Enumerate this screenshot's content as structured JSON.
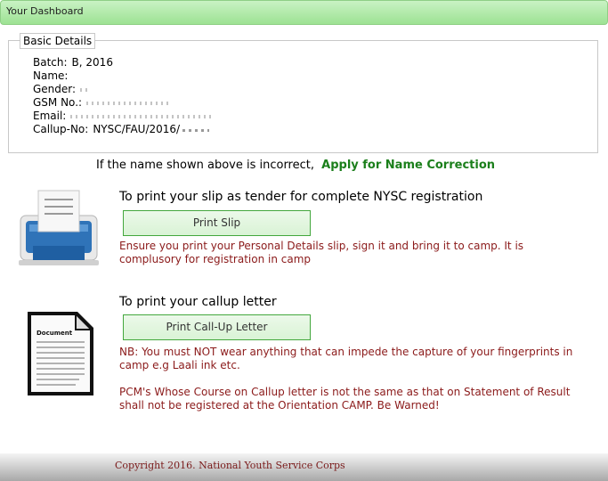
{
  "header": {
    "title": "Your Dashboard"
  },
  "basic_details": {
    "legend": "Basic Details",
    "fields": [
      {
        "label": "Batch:",
        "value": "B, 2016"
      },
      {
        "label": "Name:",
        "value": ""
      },
      {
        "label": "Gender:",
        "value": ""
      },
      {
        "label": "GSM No.:",
        "value": ""
      },
      {
        "label": "Email:",
        "value": ""
      },
      {
        "label": "Callup-No:",
        "value": "NYSC/FAU/2016/"
      }
    ]
  },
  "name_correction": {
    "text": "If the name shown above is incorrect,",
    "link": "Apply for Name Correction"
  },
  "slip": {
    "heading": "To print your slip as tender for complete NYSC registration",
    "button": "Print Slip",
    "note": "Ensure you print your Personal Details slip, sign it and bring it to camp. It is complusory for registration in camp"
  },
  "letter": {
    "heading": "To print your callup letter",
    "button": "Print Call-Up Letter",
    "note1": "NB: You must NOT wear anything that can impede the capture of your fingerprints in camp e.g Laali ink etc.",
    "note2": "PCM's Whose Course on Callup letter is not the same as that on Statement of Result shall not be registered at the Orientation CAMP. Be Warned!"
  },
  "footer": {
    "text": "Copyright 2016. National Youth Service Corps"
  },
  "icons": {
    "printer": "printer-icon",
    "document": "document-icon"
  },
  "colors": {
    "header_green": "#9de293",
    "button_border": "#43a73d",
    "warning_red": "#8b1a1a",
    "link_green": "#1b7f1b"
  }
}
